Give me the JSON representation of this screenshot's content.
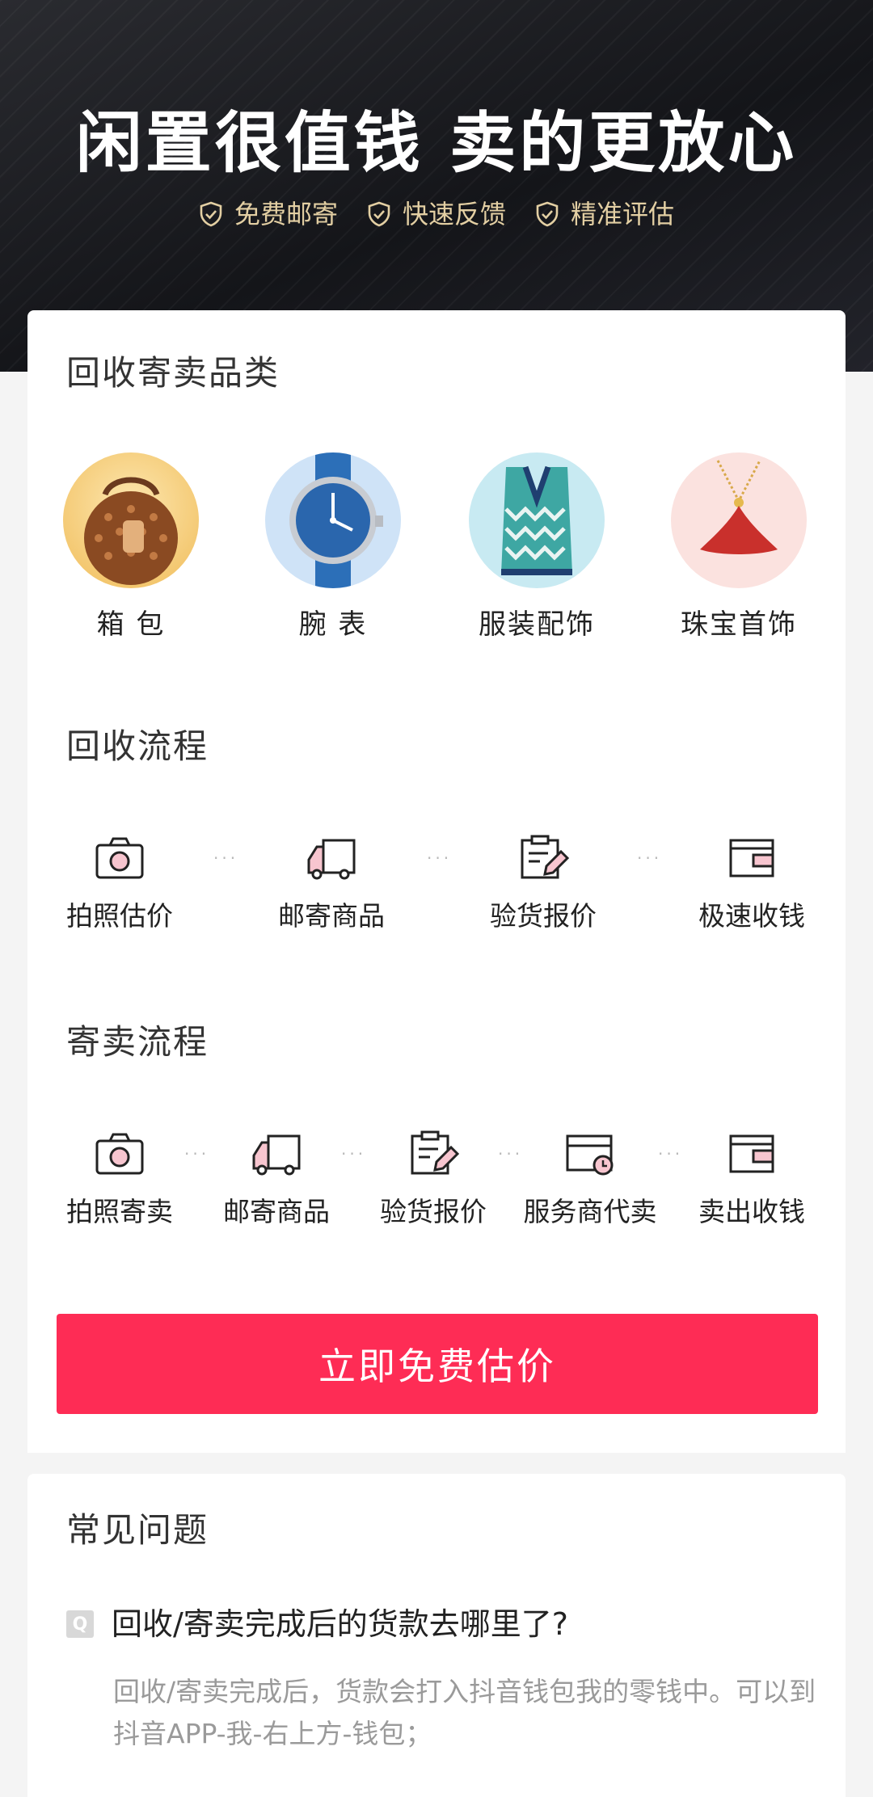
{
  "hero": {
    "title": "闲置很值钱  卖的更放心",
    "features": [
      "免费邮寄",
      "快速反馈",
      "精准评估"
    ]
  },
  "categories": {
    "title": "回收寄卖品类",
    "items": [
      {
        "label": "箱 包",
        "icon": "handbag-icon"
      },
      {
        "label": "腕 表",
        "icon": "watch-icon"
      },
      {
        "label": "服装配饰",
        "icon": "sweater-vest-icon"
      },
      {
        "label": "珠宝首饰",
        "icon": "necklace-icon"
      }
    ]
  },
  "recycle_flow": {
    "title": "回收流程",
    "steps": [
      {
        "label": "拍照估价",
        "icon": "camera-icon"
      },
      {
        "label": "邮寄商品",
        "icon": "truck-icon"
      },
      {
        "label": "验货报价",
        "icon": "clipboard-edit-icon"
      },
      {
        "label": "极速收钱",
        "icon": "wallet-icon"
      }
    ]
  },
  "consign_flow": {
    "title": "寄卖流程",
    "steps": [
      {
        "label": "拍照寄卖",
        "icon": "camera-icon"
      },
      {
        "label": "邮寄商品",
        "icon": "truck-icon"
      },
      {
        "label": "验货报价",
        "icon": "clipboard-edit-icon"
      },
      {
        "label": "服务商代卖",
        "icon": "store-clock-icon"
      },
      {
        "label": "卖出收钱",
        "icon": "wallet-icon"
      }
    ]
  },
  "cta": {
    "label": "立即免费估价"
  },
  "faq": {
    "title": "常见问题",
    "badge": "Q",
    "question": "回收/寄卖完成后的货款去哪里了?",
    "answer": "回收/寄卖完成后，货款会打入抖音钱包我的零钱中。可以到抖音APP-我-右上方-钱包；"
  },
  "colors": {
    "accent": "#fe2c55",
    "hero_bg": "#1d1e22",
    "feature_gold": "#e3cfa3",
    "icon_pink": "#f7c5cf"
  }
}
